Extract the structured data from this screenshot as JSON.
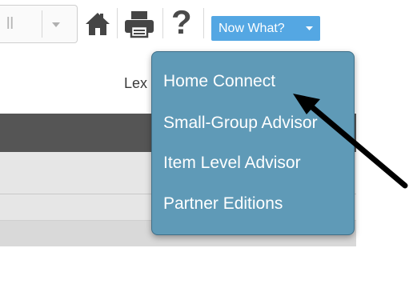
{
  "toolbar": {
    "select_value": "ll",
    "icons": [
      "home-icon",
      "print-icon",
      "help-icon"
    ],
    "help_glyph": "?",
    "now_what_label": "Now What?"
  },
  "header": {
    "partial_label": "Lex"
  },
  "dropdown": {
    "items": [
      {
        "label": "Home Connect"
      },
      {
        "label": "Small-Group Advisor"
      },
      {
        "label": "Item Level Advisor"
      },
      {
        "label": "Partner Editions"
      }
    ]
  },
  "colors": {
    "menu_bg": "#5f9ab7",
    "button_bg": "#54a7e3",
    "dark_band": "#555555"
  }
}
